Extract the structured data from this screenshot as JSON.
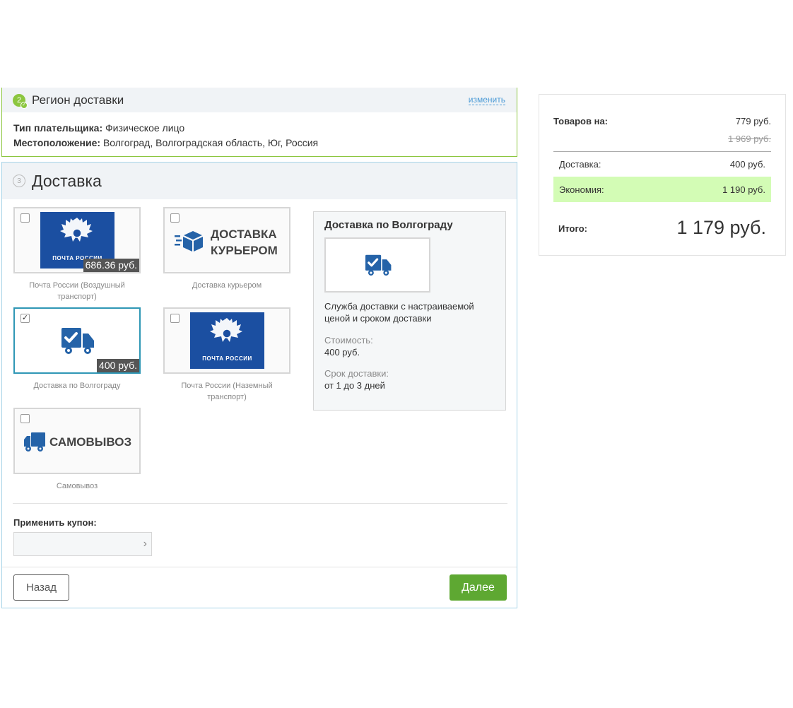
{
  "region": {
    "step": "2",
    "title": "Регион доставки",
    "change_link": "изменить",
    "payer_label": "Тип плательщика:",
    "payer_value": "Физическое лицо",
    "location_label": "Местоположение:",
    "location_value": "Волгоград, Волгоградская область, Юг, Россия"
  },
  "delivery": {
    "step": "3",
    "title": "Доставка",
    "options": [
      {
        "caption": "Почта России (Воздушный транспорт)",
        "price": "686.36 руб.",
        "logo_text": "ПОЧТА РОССИИ",
        "checked": false
      },
      {
        "caption": "Доставка курьером",
        "logo_line1": "ДОСТАВКА",
        "logo_line2": "КУРЬЕРОМ",
        "checked": false
      },
      {
        "caption": "Доставка по Волгограду",
        "price": "400 руб.",
        "checked": true
      },
      {
        "caption": "Почта России (Наземный транспорт)",
        "logo_text": "ПОЧТА РОССИИ",
        "checked": false
      },
      {
        "caption": "Самовывоз",
        "logo_text": "САМОВЫВОЗ",
        "checked": false
      }
    ],
    "info": {
      "title": "Доставка по Волгограду",
      "description": "Служба доставки с настраиваемой ценой и сроком доставки",
      "cost_label": "Стоимость:",
      "cost_value": "400 руб.",
      "term_label": "Срок доставки:",
      "term_value": "от 1 до 3 дней"
    },
    "coupon_label": "Применить купон:",
    "coupon_placeholder": "",
    "back_label": "Назад",
    "next_label": "Далее"
  },
  "summary": {
    "goods_label": "Товаров на:",
    "goods_value": "779 руб.",
    "goods_old_value": "1 969 руб.",
    "delivery_label": "Доставка:",
    "delivery_value": "400 руб.",
    "economy_label": "Экономия:",
    "economy_value": "1 190 руб.",
    "total_label": "Итого:",
    "total_value": "1 179 руб."
  },
  "colors": {
    "accent_green": "#5ea832",
    "region_border": "#8cc63f",
    "selected_border": "#2f97b5",
    "pochta_blue": "#1b4fa1",
    "economy_bg": "#d3fcb5"
  },
  "icons": [
    "check-icon",
    "eagle-emblem-icon",
    "box-icon",
    "truck-check-icon",
    "truck-icon",
    "chevron-right-icon"
  ]
}
